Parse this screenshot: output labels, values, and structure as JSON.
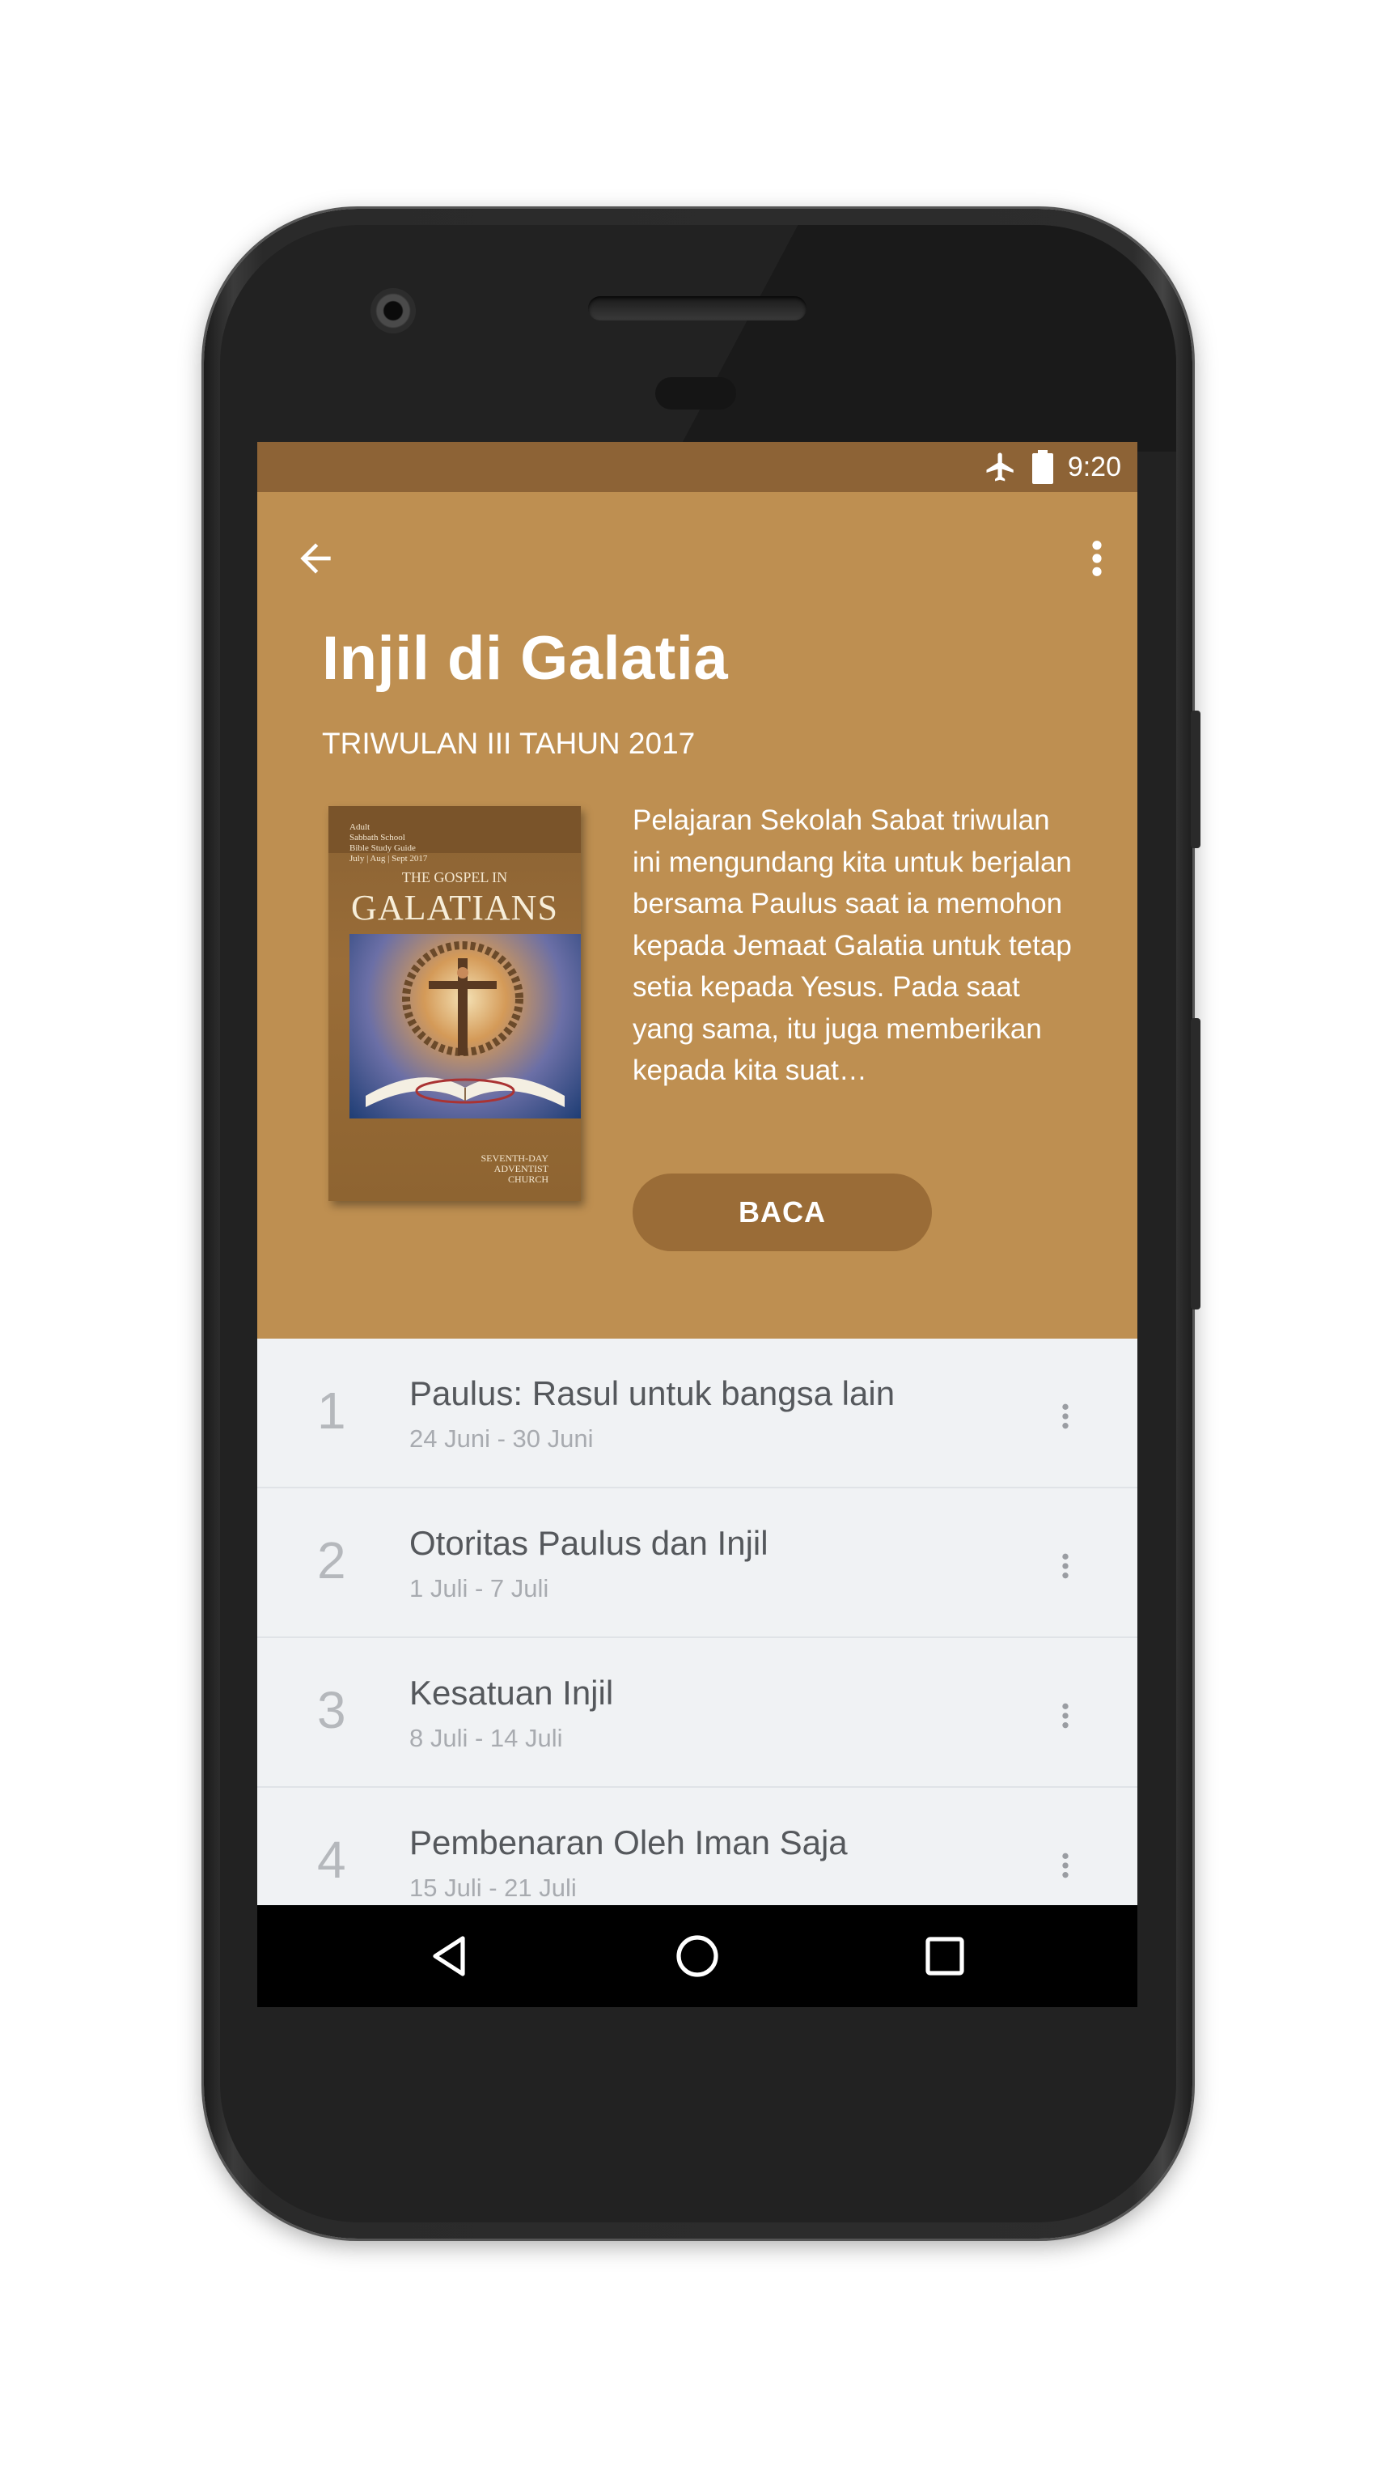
{
  "status_bar": {
    "time": "9:20",
    "icons": [
      "airplane-mode-icon",
      "battery-icon"
    ],
    "background": "#8d6336"
  },
  "header": {
    "background": "#be8f51",
    "title": "Injil di Galatia",
    "subtitle": "TRIWULAN III TAHUN 2017",
    "description": "Pelajaran Sekolah Sabat triwulan ini mengundang kita untuk berjalan bersama Paulus saat ia memohon kepada Jemaat Galatia untuk tetap setia kepada Yesus. Pada saat yang sama, itu juga memberikan kepada kita suat…",
    "read_button_label": "BACA",
    "icons": {
      "back": "arrow-back-icon",
      "overflow": "more-vert-icon"
    }
  },
  "cover": {
    "top_text_lines": [
      "Adult",
      "Sabbath School",
      "Bible Study Guide",
      "July | Aug | Sept 2017"
    ],
    "heading_small": "THE GOSPEL IN",
    "heading_large": "GALATIANS",
    "footer_lines": [
      "SEVENTH-DAY",
      "ADVENTIST",
      "CHURCH"
    ]
  },
  "lessons": [
    {
      "number": "1",
      "title": "Paulus: Rasul untuk bangsa lain",
      "date": "24 Juni - 30 Juni"
    },
    {
      "number": "2",
      "title": "Otoritas Paulus dan Injil",
      "date": "1 Juli - 7 Juli"
    },
    {
      "number": "3",
      "title": "Kesatuan Injil",
      "date": "8 Juli - 14 Juli"
    },
    {
      "number": "4",
      "title": "Pembenaran Oleh Iman Saja",
      "date": "15 Juli - 21 Juli"
    }
  ],
  "nav_bar": {
    "buttons": [
      "nav-back-icon",
      "nav-home-icon",
      "nav-recent-apps-icon"
    ]
  }
}
